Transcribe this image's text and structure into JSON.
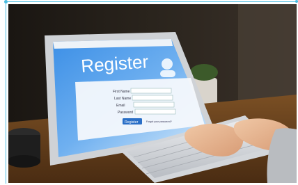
{
  "screen": {
    "heading": "Register",
    "fields": [
      "First Name",
      "Last Name",
      "Email",
      "Password"
    ],
    "button_label": "Register",
    "link_text": "Forgot your password?"
  },
  "colors": {
    "accent_guide": "#4bbce0",
    "screen_blue": "#2f7fd8",
    "button_blue": "#2a6fc7"
  }
}
